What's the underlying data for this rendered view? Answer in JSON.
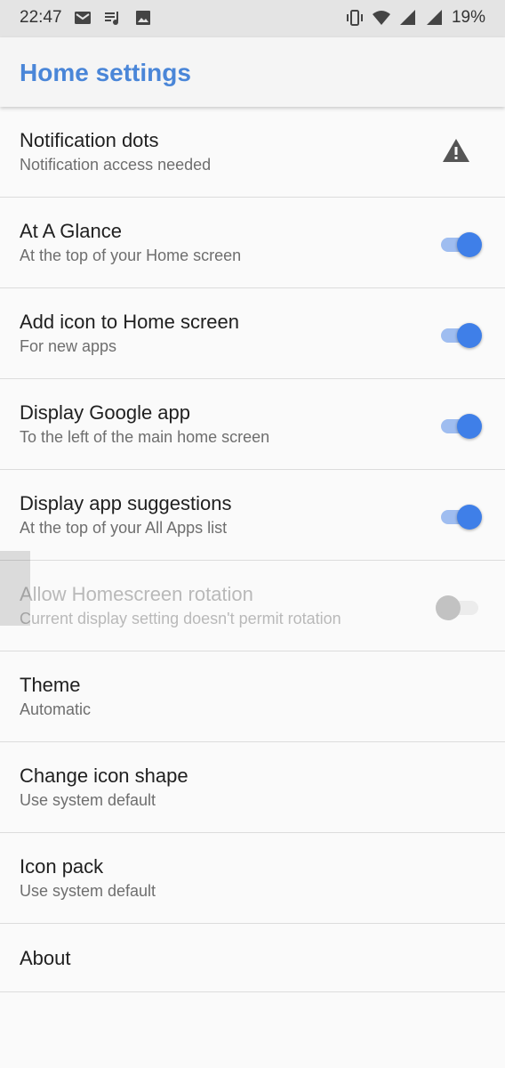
{
  "status_bar": {
    "time": "22:47",
    "battery": "19%",
    "left_icons": [
      "gmail-icon",
      "music-queue-icon",
      "image-icon"
    ],
    "right_icons": [
      "vibrate-icon",
      "wifi-icon",
      "signal-icon",
      "signal-icon"
    ]
  },
  "app_bar": {
    "title": "Home settings",
    "accent_color": "#4a86d8"
  },
  "settings": [
    {
      "title": "Notification dots",
      "subtitle": "Notification access needed",
      "control": "warning-icon"
    },
    {
      "title": "At A Glance",
      "subtitle": "At the top of your Home screen",
      "control": "toggle",
      "on": true
    },
    {
      "title": "Add icon to Home screen",
      "subtitle": "For new apps",
      "control": "toggle",
      "on": true
    },
    {
      "title": "Display Google app",
      "subtitle": "To the left of the main home screen",
      "control": "toggle",
      "on": true
    },
    {
      "title": "Display app suggestions",
      "subtitle": "At the top of your All Apps list",
      "control": "toggle",
      "on": true
    },
    {
      "title": "Allow Homescreen rotation",
      "subtitle": "Current display setting doesn't permit rotation",
      "control": "toggle",
      "on": false,
      "disabled": true
    },
    {
      "title": "Theme",
      "subtitle": "Automatic"
    },
    {
      "title": "Change icon shape",
      "subtitle": "Use system default"
    },
    {
      "title": "Icon pack",
      "subtitle": "Use system default"
    },
    {
      "title": "About"
    }
  ],
  "colors": {
    "toggle_on_thumb": "#3f7fe8",
    "toggle_on_track": "#9fbdf0",
    "toggle_off_thumb": "#c2c2c2"
  }
}
